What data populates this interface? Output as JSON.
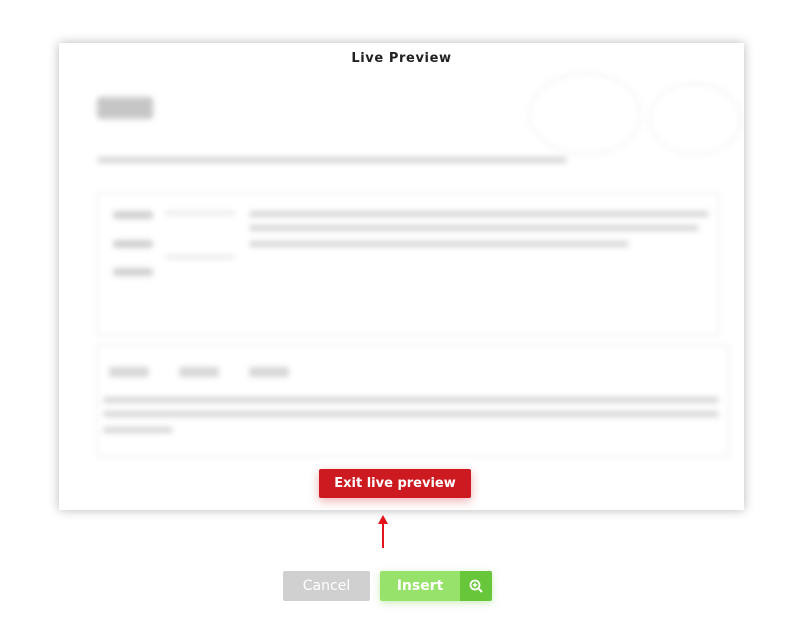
{
  "modal": {
    "title": "Live Preview",
    "exit_button_label": "Exit live preview"
  },
  "actions": {
    "cancel_label": "Cancel",
    "insert_label": "Insert",
    "zoom_icon": "zoom-in-icon"
  },
  "colors": {
    "exit_button": "#cc1a20",
    "cancel_button": "#d0d0d0",
    "insert_button": "#97e26a",
    "zoom_button": "#68c63a",
    "arrow": "#e3151a"
  }
}
